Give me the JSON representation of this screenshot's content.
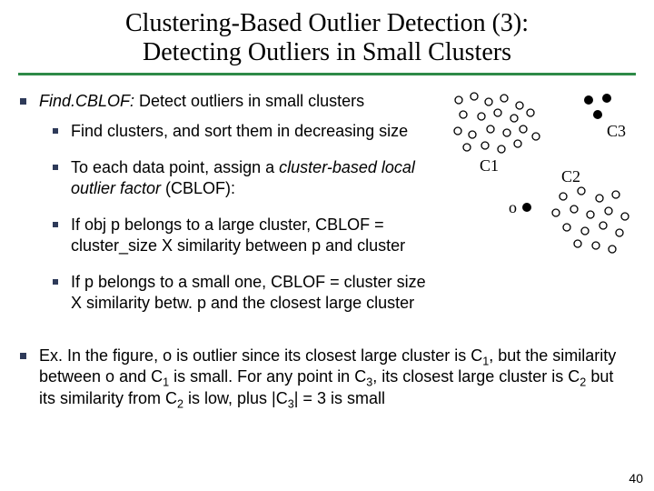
{
  "title_line1": "Clustering-Based Outlier Detection (3):",
  "title_line2": "Detecting Outliers in Small Clusters",
  "bullets": {
    "b1_prefix_ital": "Find.CBLOF:",
    "b1_rest": " Detect outliers in small clusters",
    "b1a": "Find clusters, and sort them in decreasing size",
    "b1b_pre": "To each data point, assign a ",
    "b1b_ital": "cluster-based local outlier factor",
    "b1b_post": " (CBLOF):",
    "b1c": "If obj p belongs to a large cluster, CBLOF = cluster_size X similarity between p and cluster",
    "b1d": "If p belongs to a small one, CBLOF = cluster size X  similarity betw. p and the closest large cluster"
  },
  "example": {
    "pre": "Ex. In the figure, o is outlier since its closest large cluster is C",
    "s1": "1",
    "mid1": ", but the similarity between o and C",
    "s2": "1",
    "mid2": " is small. For any point in C",
    "s3": "3",
    "mid3": ", its closest large cluster is C",
    "s4": "2",
    "mid4": " but its similarity from C",
    "s5": "2",
    "mid5": " is low, plus |C",
    "s6": "3",
    "post": "| = 3 is small"
  },
  "fig": {
    "C1": "C1",
    "C2": "C2",
    "C3": "C3",
    "o": "o"
  },
  "pagenum": "40"
}
